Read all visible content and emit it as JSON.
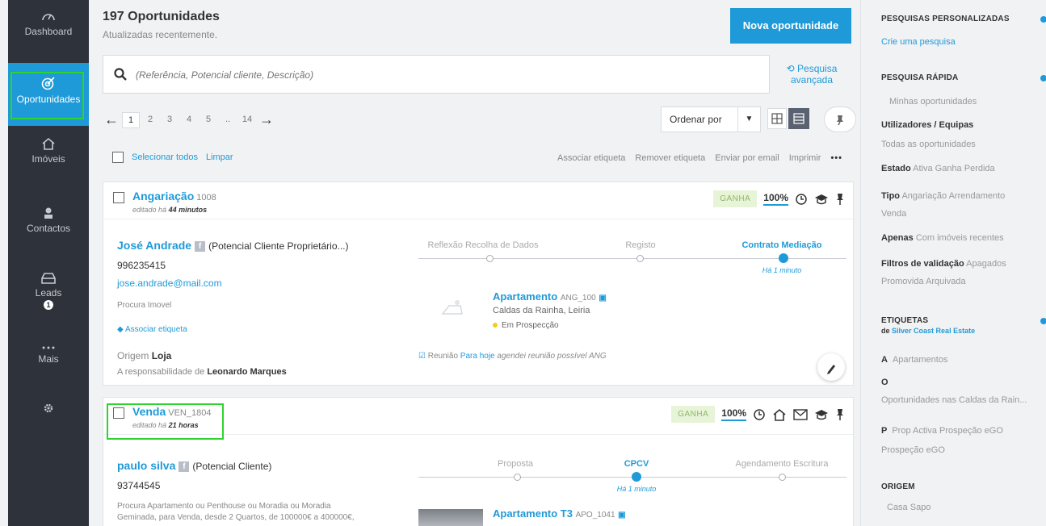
{
  "sidebar": {
    "items": [
      {
        "label": "Dashboard",
        "icon": "gauge-icon"
      },
      {
        "label": "Oportunidades",
        "icon": "target-icon",
        "active": true
      },
      {
        "label": "Imóveis",
        "icon": "house-icon"
      },
      {
        "label": "Contactos",
        "icon": "person-icon"
      },
      {
        "label": "Leads",
        "icon": "inbox-icon",
        "badge": "1"
      },
      {
        "label": "Mais",
        "icon": "more-icon"
      },
      {
        "label": "",
        "icon": "gear-icon"
      }
    ]
  },
  "header": {
    "title": "197 Oportunidades",
    "subtitle": "Atualizadas recentemente.",
    "new_button": "Nova oportunidade"
  },
  "search": {
    "placeholder": "(Referência, Potencial cliente, Descrição)",
    "advanced_line1": "Pesquisa",
    "advanced_line2": "avançada"
  },
  "pagination": {
    "pages": [
      "1",
      "2",
      "3",
      "4",
      "5",
      "..",
      "14"
    ],
    "current": "1"
  },
  "toolbar": {
    "order_label": "Ordenar por"
  },
  "bulk": {
    "select_all": "Selecionar todos",
    "clear": "Limpar",
    "actions": [
      "Associar etiqueta",
      "Remover etiqueta",
      "Enviar por email",
      "Imprimir"
    ],
    "more": "•••"
  },
  "cards": [
    {
      "title": "Angariação",
      "ref": "1008",
      "edited_prefix": "editado há",
      "edited_time": "44 minutos",
      "status": "GANHA",
      "percent": "100%",
      "contact_name": "José Andrade",
      "contact_type": "(Potencial Cliente Proprietário...)",
      "phone": "996235415",
      "email": "jose.andrade@mail.com",
      "looking_for": "Procura Imovel",
      "assoc_tag": "Associar etiqueta",
      "origin_label": "Origem",
      "origin_value": "Loja",
      "responsible_prefix": "A responsabilidade de",
      "responsible_name": "Leonardo Marques",
      "pipeline": [
        "Reflexão Recolha de Dados",
        "Registo",
        "Contrato Mediação"
      ],
      "pipeline_time": "Há 1 minuto",
      "property_title": "Apartamento",
      "property_ref": "ANG_100",
      "property_location": "Caldas da Rainha, Leiria",
      "property_state": "Em Prospecção",
      "task_label": "Reunião",
      "task_when": "Para hoje",
      "task_desc": "agendei reunião possível ANG"
    },
    {
      "title": "Venda",
      "ref": "VEN_1804",
      "edited_prefix": "editado há",
      "edited_time": "21 horas",
      "status": "GANHA",
      "percent": "100%",
      "contact_name": "paulo silva",
      "contact_type": "(Potencial Cliente)",
      "phone": "93744545",
      "description_line1": "Procura Apartamento ou Penthouse ou Moradia ou Moradia",
      "description_line2": "Geminada, para Venda, desde 2 Quartos, de 100000€ a 400000€,",
      "pipeline": [
        "Proposta",
        "CPCV",
        "Agendamento Escritura"
      ],
      "pipeline_time": "Há 1 minuto",
      "property_title": "Apartamento T3",
      "property_ref": "APO_1041"
    }
  ],
  "right_panel": {
    "custom_search_heading": "PESQUISAS PERSONALIZADAS",
    "create_search": "Crie uma pesquisa",
    "quick_search_heading": "PESQUISA RÁPIDA",
    "my_opportunities": "Minhas oportunidades",
    "users_teams": "Utilizadores / Equipas",
    "all_opportunities": "Todas as oportunidades",
    "estado_label": "Estado",
    "estado_values": "Ativa  Ganha  Perdida",
    "tipo_label": "Tipo",
    "tipo_values": "Angariação  Arrendamento",
    "tipo_values2": "Venda",
    "apenas_label": "Apenas",
    "apenas_values": "Com imóveis recentes",
    "filtros_label": "Filtros de validação",
    "filtros_values": "Apagados",
    "filtros_values2": "Promovida  Arquivada",
    "tags_heading": "ETIQUETAS",
    "tags_sub_prefix": "de",
    "tags_sub_org": "Silver Coast Real Estate",
    "tag_a_letter": "A",
    "tag_a_value": "Apartamentos",
    "tag_o_letter": "O",
    "tag_o_value": "Oportunidades nas Caldas da Rain...",
    "tag_p_letter": "P",
    "tag_p_value": "Prop Activa  Prospeção eGO",
    "tag_p_value2": "Prospeção eGO",
    "origem_heading": "ORIGEM",
    "origem_value": "Casa Sapo"
  },
  "colors": {
    "accent": "#1f9ad8",
    "sidebar_bg": "#2e323a",
    "highlight": "#2fd32f",
    "won_tag_bg": "#e7f4d7"
  }
}
